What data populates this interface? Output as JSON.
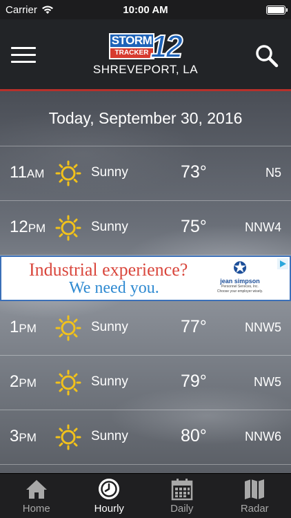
{
  "status_bar": {
    "carrier": "Carrier",
    "time": "10:00 AM"
  },
  "header": {
    "logo": {
      "storm": "STORM",
      "tracker": "TRACKER",
      "number": "12"
    },
    "location": "SHREVEPORT, LA"
  },
  "date_label": "Today, September 30, 2016",
  "hours": [
    {
      "hour": "11",
      "period": "AM",
      "icon": "sun-icon",
      "condition": "Sunny",
      "temp": "73°",
      "wind": "N5"
    },
    {
      "hour": "12",
      "period": "PM",
      "icon": "sun-icon",
      "condition": "Sunny",
      "temp": "75°",
      "wind": "NNW4"
    },
    {
      "hour": "1",
      "period": "PM",
      "icon": "sun-icon",
      "condition": "Sunny",
      "temp": "77°",
      "wind": "NNW5"
    },
    {
      "hour": "2",
      "period": "PM",
      "icon": "sun-icon",
      "condition": "Sunny",
      "temp": "79°",
      "wind": "NW5"
    },
    {
      "hour": "3",
      "period": "PM",
      "icon": "sun-icon",
      "condition": "Sunny",
      "temp": "80°",
      "wind": "NNW6"
    }
  ],
  "ad": {
    "line1": "Industrial experience?",
    "line2": "We need you.",
    "brand": "jean simpson",
    "brand_sub": "Personnel Services, Inc.",
    "tagline": "Choose your employer wisely."
  },
  "tabs": [
    {
      "label": "Home",
      "icon": "home-icon",
      "active": false
    },
    {
      "label": "Hourly",
      "icon": "clock-icon",
      "active": true
    },
    {
      "label": "Daily",
      "icon": "calendar-icon",
      "active": false
    },
    {
      "label": "Radar",
      "icon": "map-icon",
      "active": false
    }
  ],
  "colors": {
    "accent_red": "#b8302a",
    "sun_yellow": "#f2c21b",
    "logo_blue": "#1e63b8"
  }
}
